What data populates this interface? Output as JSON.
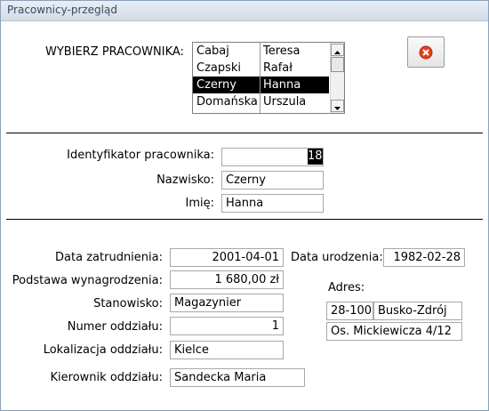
{
  "window": {
    "title": "Pracownicy-przegląd"
  },
  "selector": {
    "label": "WYBIERZ PRACOWNIKA:",
    "rows": [
      {
        "surname": "Cabaj",
        "name": "Teresa"
      },
      {
        "surname": "Czapski",
        "name": "Rafał"
      },
      {
        "surname": "Czerny",
        "name": "Hanna"
      },
      {
        "surname": "Domańska",
        "name": "Urszula"
      }
    ],
    "selected_index": 2
  },
  "close_button": {
    "icon": "close-icon",
    "color": "#e3401f"
  },
  "employee": {
    "id_label": "Identyfikator pracownika:",
    "id_value": "18",
    "surname_label": "Nazwisko:",
    "surname_value": "Czerny",
    "name_label": "Imię:",
    "name_value": "Hanna"
  },
  "details": {
    "hire_date_label": "Data zatrudnienia:",
    "hire_date_value": "2001-04-01",
    "birth_date_label": "Data urodzenia:",
    "birth_date_value": "1982-02-28",
    "salary_label": "Podstawa wynagrodzenia:",
    "salary_value": "1 680,00 zł",
    "position_label": "Stanowisko:",
    "position_value": "Magazynier",
    "branch_no_label": "Numer oddziału:",
    "branch_no_value": "1",
    "branch_loc_label": "Lokalizacja oddziału:",
    "branch_loc_value": "Kielce",
    "manager_label": "Kierownik oddziału:",
    "manager_value": "Sandecka  Maria"
  },
  "address": {
    "label": "Adres:",
    "postal_code": "28-100",
    "city": "Busko-Zdrój",
    "street": "Os. Mickiewicza 4/12"
  }
}
